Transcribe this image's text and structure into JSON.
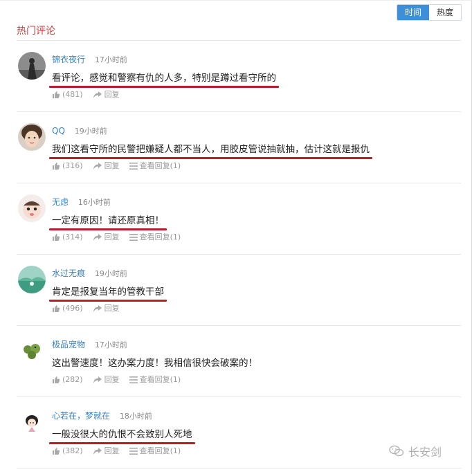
{
  "sort_tabs": [
    {
      "label": "时间",
      "active": true
    },
    {
      "label": "热度",
      "active": false
    }
  ],
  "section_title": "热门评论",
  "comments": [
    {
      "author": "锦衣夜行",
      "time": "17小时前",
      "text": "看评论，感觉和警察有仇的人多，特别是蹲过看守所的",
      "likes": "(481)",
      "reply_label": "回复",
      "view_replies": "",
      "avatar": "dark-figure-avatar",
      "underlined": true
    },
    {
      "author": "QQ",
      "time": "19小时前",
      "text": "我们这看守所的民警把嫌疑人都不当人，用胶皮管说抽就抽，估计这就是报仇",
      "likes": "(316)",
      "reply_label": "回复",
      "view_replies": "查看回复(1)",
      "avatar": "girl-face-avatar",
      "underlined": true
    },
    {
      "author": "无虑",
      "time": "16小时前",
      "text": "一定有原因！请还原真相！",
      "likes": "(314)",
      "reply_label": "回复",
      "view_replies": "查看回复(1)",
      "avatar": "baby-face-avatar",
      "underlined": true
    },
    {
      "author": "水过无痕",
      "time": "19小时前",
      "text": "肯定是报复当年的管教干部",
      "likes": "(496)",
      "reply_label": "回复",
      "view_replies": "",
      "avatar": "landscape-avatar",
      "underlined": true
    },
    {
      "author": "极品宠物",
      "time": "17小时前",
      "text": "这出警速度！这办案力度！我相信很快会破案的！",
      "likes": "(282)",
      "reply_label": "回复",
      "view_replies": "查看回复(1)",
      "avatar": "green-toy-avatar",
      "underlined": false
    },
    {
      "author": "心若在，梦就在",
      "time": "18小时前",
      "text": "一般没很大的仇恨不会致别人死地",
      "likes": "(382)",
      "reply_label": "回复",
      "view_replies": "查看回复(1)",
      "avatar": "cartoon-girl-avatar",
      "underlined": true
    }
  ],
  "watermark": "长安剑",
  "colors": {
    "accent": "#3f8fd6",
    "title_red": "#c84142",
    "underline_red": "#b81d2a",
    "author_blue": "#3a7fb8"
  }
}
